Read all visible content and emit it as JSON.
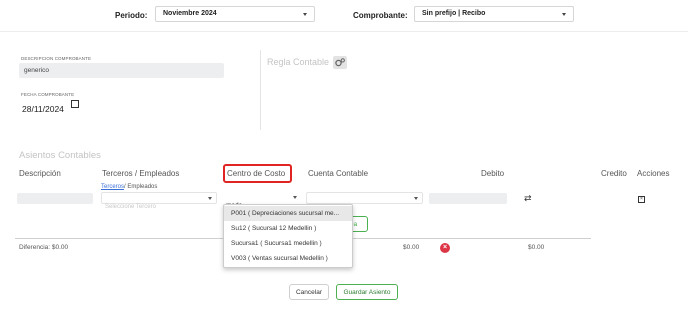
{
  "header": {
    "period_label": "Periodo:",
    "period_value": "Noviembre 2024",
    "comprobante_label": "Comprobante:",
    "comprobante_value": "Sin prefijo | Recibo"
  },
  "form": {
    "descripcion_label": "DESCRIPCION COMPROBANTE",
    "descripcion_value": "generico",
    "fecha_label": "FECHA COMPROBANTE",
    "fecha_value": "28/11/2024",
    "regla_label": "Regla Contable"
  },
  "asientos": {
    "title": "Asientos Contables",
    "columns": {
      "descripcion": "Descripción",
      "terceros": "Terceros / Empleados",
      "centro": "Centro de Costo",
      "cuenta": "Cuenta Contable",
      "debito": "Debito",
      "credito": "Credito",
      "acciones": "Acciones"
    },
    "terceros_link": "Terceros",
    "terceros_suffix": "/ Empleados",
    "terceros_placeholder": "Seleccione Tercero",
    "centro_search_value": "mede",
    "centro_options": [
      "P001 ( Depreciaciones sucursal me...",
      "Su12 ( Sucursal 12 Medellin )",
      "Sucursa1 ( Sucursa1 medellin )",
      "V003 ( Ventas sucursal Medellin )"
    ],
    "hidden_button_text": "ea",
    "diferencia_label": "Diferencia: $0.00",
    "total_debito": "$0.00",
    "total_credito": "$0.00"
  },
  "actions": {
    "cancel_label": "Cancelar",
    "save_label": "Guardar Asiento"
  },
  "colors": {
    "highlight_red": "#e02424",
    "green_button": "#4caf50",
    "delete_red": "#dc3545"
  }
}
